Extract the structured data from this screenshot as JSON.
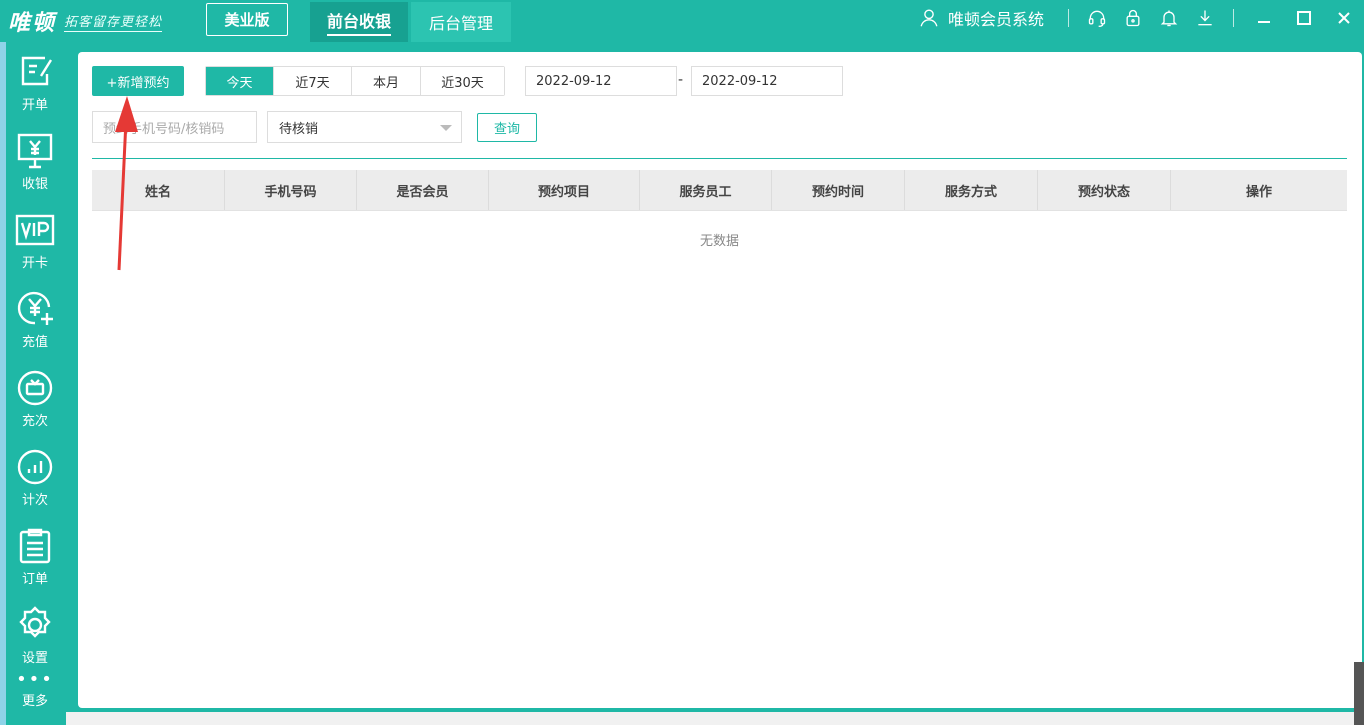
{
  "app": {
    "logo_text": "唯顿",
    "logo_slogan": "拓客留存更轻松",
    "edition": "美业版",
    "tabs": [
      {
        "label": "前台收银",
        "active": true
      },
      {
        "label": "后台管理",
        "active": false
      }
    ],
    "system_name": "唯顿会员系统",
    "header_icons": [
      "user-icon",
      "headset-icon",
      "lock-icon",
      "bell-icon",
      "download-icon"
    ],
    "window_controls": [
      "minimize-icon",
      "maximize-icon",
      "close-icon"
    ]
  },
  "sidebar": {
    "items": [
      {
        "label": "开单",
        "icon": "edit-order-icon"
      },
      {
        "label": "收银",
        "icon": "cashier-monitor-icon"
      },
      {
        "label": "开卡",
        "icon": "vip-card-icon"
      },
      {
        "label": "充值",
        "icon": "yuan-plus-icon"
      },
      {
        "label": "充次",
        "icon": "recharge-count-icon"
      },
      {
        "label": "计次",
        "icon": "chart-count-icon"
      },
      {
        "label": "订单",
        "icon": "clipboard-icon"
      },
      {
        "label": "设置",
        "icon": "gear-icon"
      }
    ],
    "more_label": "更多",
    "more_icon": "•••"
  },
  "toolbar": {
    "add_label": "+新增预约",
    "ranges": [
      {
        "label": "今天",
        "active": true
      },
      {
        "label": "近7天",
        "active": false
      },
      {
        "label": "本月",
        "active": false
      },
      {
        "label": "近30天",
        "active": false
      }
    ],
    "date_start": "2022-09-12",
    "date_sep": "-",
    "date_end": "2022-09-12",
    "search_placeholder": "预约手机号码/核销码",
    "status_value": "待核销",
    "query_label": "查询"
  },
  "table": {
    "columns": [
      "姓名",
      "手机号码",
      "是否会员",
      "预约项目",
      "服务员工",
      "预约时间",
      "服务方式",
      "预约状态",
      "操作"
    ],
    "rows": [],
    "empty_text": "无数据"
  },
  "colors": {
    "brand": "#1fb8a6",
    "annotation_arrow": "#e53935"
  }
}
